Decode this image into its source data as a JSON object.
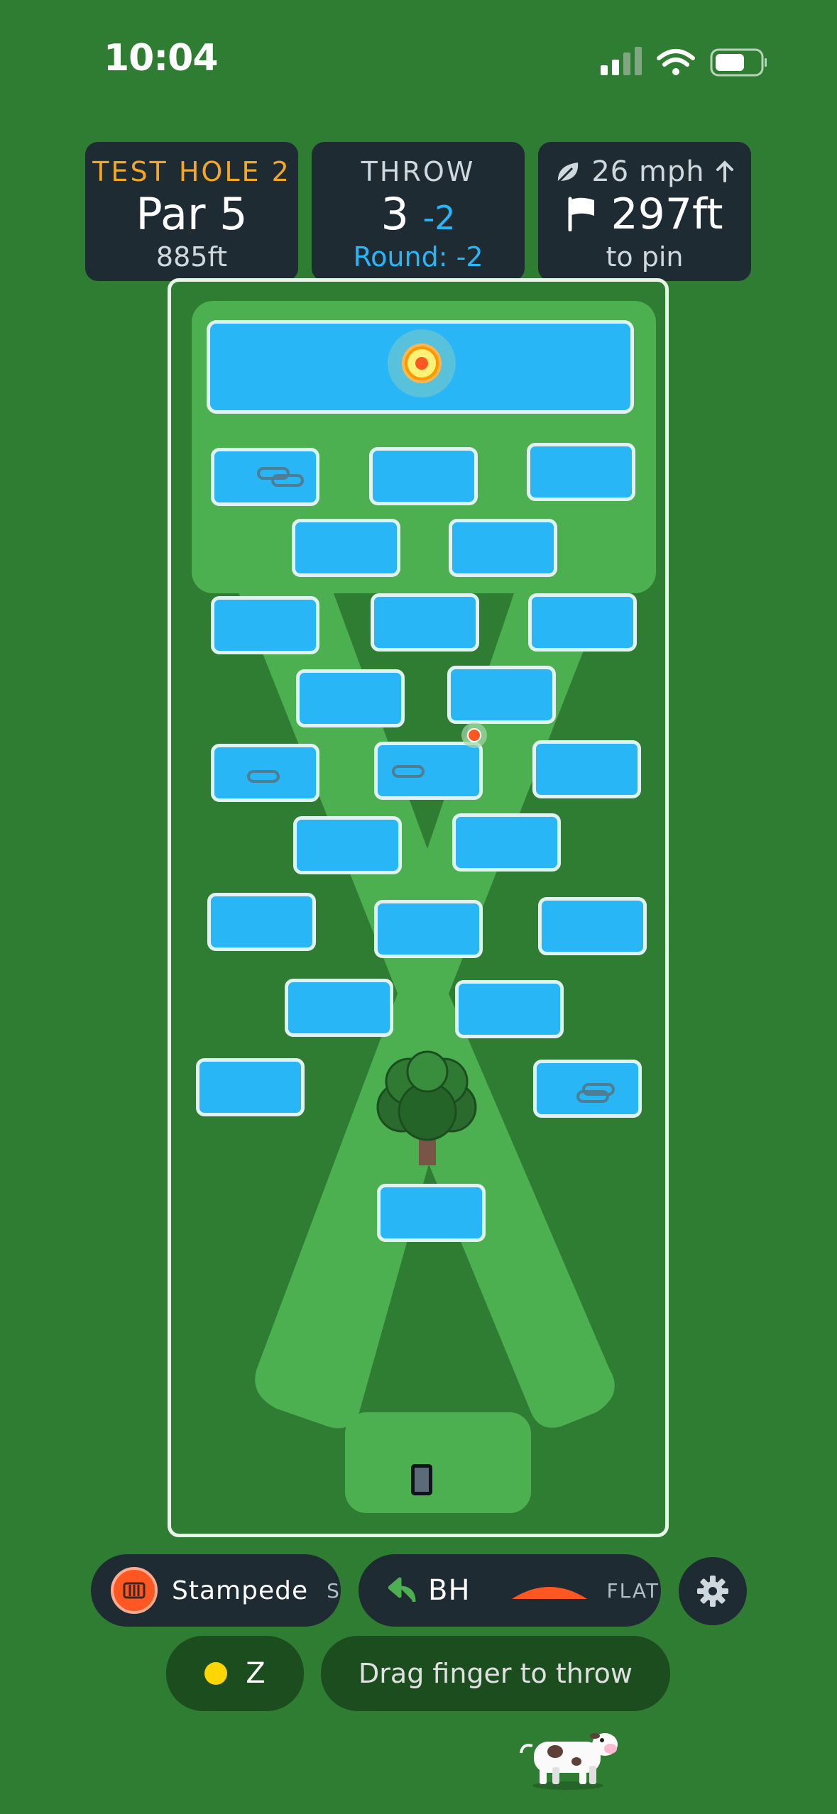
{
  "status_bar": {
    "time": "10:04",
    "icons": [
      "cellular-signal-icon",
      "wifi-icon",
      "battery-icon"
    ]
  },
  "header": {
    "hole": {
      "name": "TEST HOLE 2",
      "par": "Par 5",
      "distance": "885ft"
    },
    "throw": {
      "label": "THROW",
      "count": "3",
      "score": "-2",
      "round": "Round: -2"
    },
    "pin": {
      "wind": "26 mph",
      "distance": "297ft",
      "suffix": "to pin"
    }
  },
  "course": {
    "hazard": "water-pond",
    "features": [
      "basket",
      "tree",
      "tee-pad",
      "disc-marker",
      "fairway"
    ]
  },
  "controls": {
    "disc_name": "Stampede",
    "disc_type": "S",
    "throw_type": "BH",
    "flight": "FLAT",
    "z_label": "Z",
    "hint": "Drag finger to throw"
  },
  "colors": {
    "background": "#2e7d32",
    "fairway": "#4caf50",
    "water": "#29b6f6",
    "card": "#1f2b33",
    "accent_orange": "#f5a623",
    "accent_blue": "#29b6f6",
    "disc": "#ff5722"
  }
}
